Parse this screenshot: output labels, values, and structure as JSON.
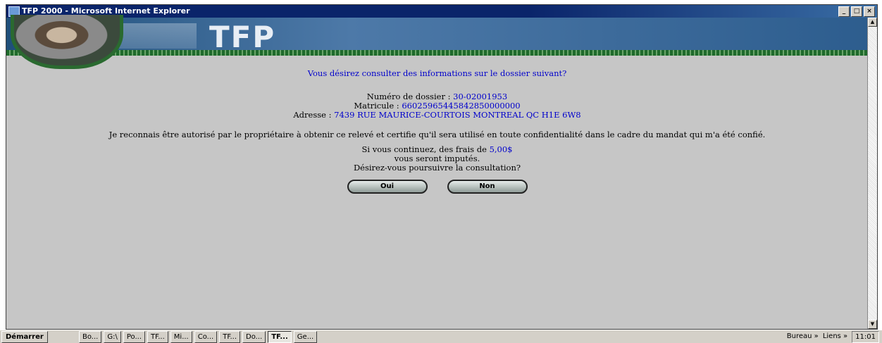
{
  "window": {
    "title": "TFP 2000 - Microsoft Internet Explorer",
    "minimize": "_",
    "maximize": "□",
    "close": "×"
  },
  "banner": {
    "logo_text": "TFP"
  },
  "content": {
    "question": "Vous désirez consulter des informations sur le dossier suivant?",
    "dossier_label": "Numéro de dossier :",
    "dossier_value": "30-02001953",
    "matricule_label": "Matricule :",
    "matricule_value": "66025965445842850000000",
    "adresse_label": "Adresse :",
    "adresse_value": "7439 RUE MAURICE-COURTOIS MONTREAL QC H1E 6W8",
    "disclaimer": "Je reconnais être autorisé par le propriétaire à obtenir ce relevé et certifie qu'il sera utilisé en toute confidentialité dans le cadre du mandat qui m'a été confié.",
    "fees_prefix": "Si vous continuez, des frais de",
    "fees_value": "5,00$",
    "fees_suffix": "vous seront imputés.",
    "confirm": "Désirez-vous poursuivre la consultation?",
    "yes_label": "Oui",
    "no_label": "Non"
  },
  "taskbar": {
    "start_label": "Démarrer",
    "items": [
      "Bo...",
      "G:\\",
      "Po...",
      "TF...",
      "Mi...",
      "Co...",
      "TF...",
      "Do...",
      "TF...",
      "Ge..."
    ],
    "active_index": 8,
    "bureau": "Bureau »",
    "liens": "Liens »",
    "clock": "11:01"
  },
  "colors": {
    "title_bar": "#0a246a",
    "page_bg": "#c6c6c6",
    "link_blue": "#0000cc",
    "banner_green": "#2a6a30"
  }
}
